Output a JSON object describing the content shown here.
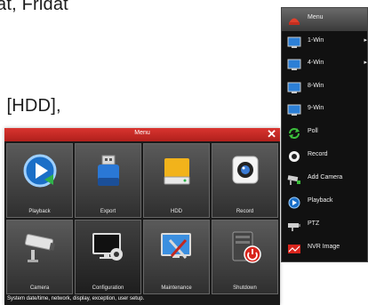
{
  "document": {
    "line1": "at, Fridat",
    "line2": ", [HDD],"
  },
  "menu": {
    "title": "Menu",
    "close_icon": "✕",
    "tiles": [
      {
        "label": "Playback",
        "icon": "playback-icon"
      },
      {
        "label": "Export",
        "icon": "usb-export-icon"
      },
      {
        "label": "HDD",
        "icon": "hdd-icon"
      },
      {
        "label": "Record",
        "icon": "record-camera-icon"
      },
      {
        "label": "Camera",
        "icon": "cctv-camera-icon"
      },
      {
        "label": "Configuration",
        "icon": "configuration-icon"
      },
      {
        "label": "Maintenance",
        "icon": "maintenance-icon"
      },
      {
        "label": "Shutdown",
        "icon": "shutdown-icon"
      }
    ],
    "status_text": "System date/time, network, display, exception, user setup."
  },
  "popup": {
    "items": [
      {
        "label": "Menu",
        "icon": "menu-icon",
        "submenu": false
      },
      {
        "label": "1-Win",
        "icon": "monitor-icon",
        "submenu": true
      },
      {
        "label": "4-Win",
        "icon": "monitor-icon",
        "submenu": true
      },
      {
        "label": "8-Win",
        "icon": "monitor-icon",
        "submenu": false
      },
      {
        "label": "9-Win",
        "icon": "monitor-icon",
        "submenu": false
      },
      {
        "label": "Poll",
        "icon": "poll-icon",
        "submenu": false
      },
      {
        "label": "Record",
        "icon": "record-icon",
        "submenu": false
      },
      {
        "label": "Add Camera",
        "icon": "add-camera-icon",
        "submenu": false
      },
      {
        "label": "Playback",
        "icon": "playback-icon",
        "submenu": false
      },
      {
        "label": "PTZ",
        "icon": "ptz-icon",
        "submenu": false
      },
      {
        "label": "NVR Image",
        "icon": "nvr-image-icon",
        "submenu": false
      }
    ],
    "submenu_arrow": "▸"
  }
}
